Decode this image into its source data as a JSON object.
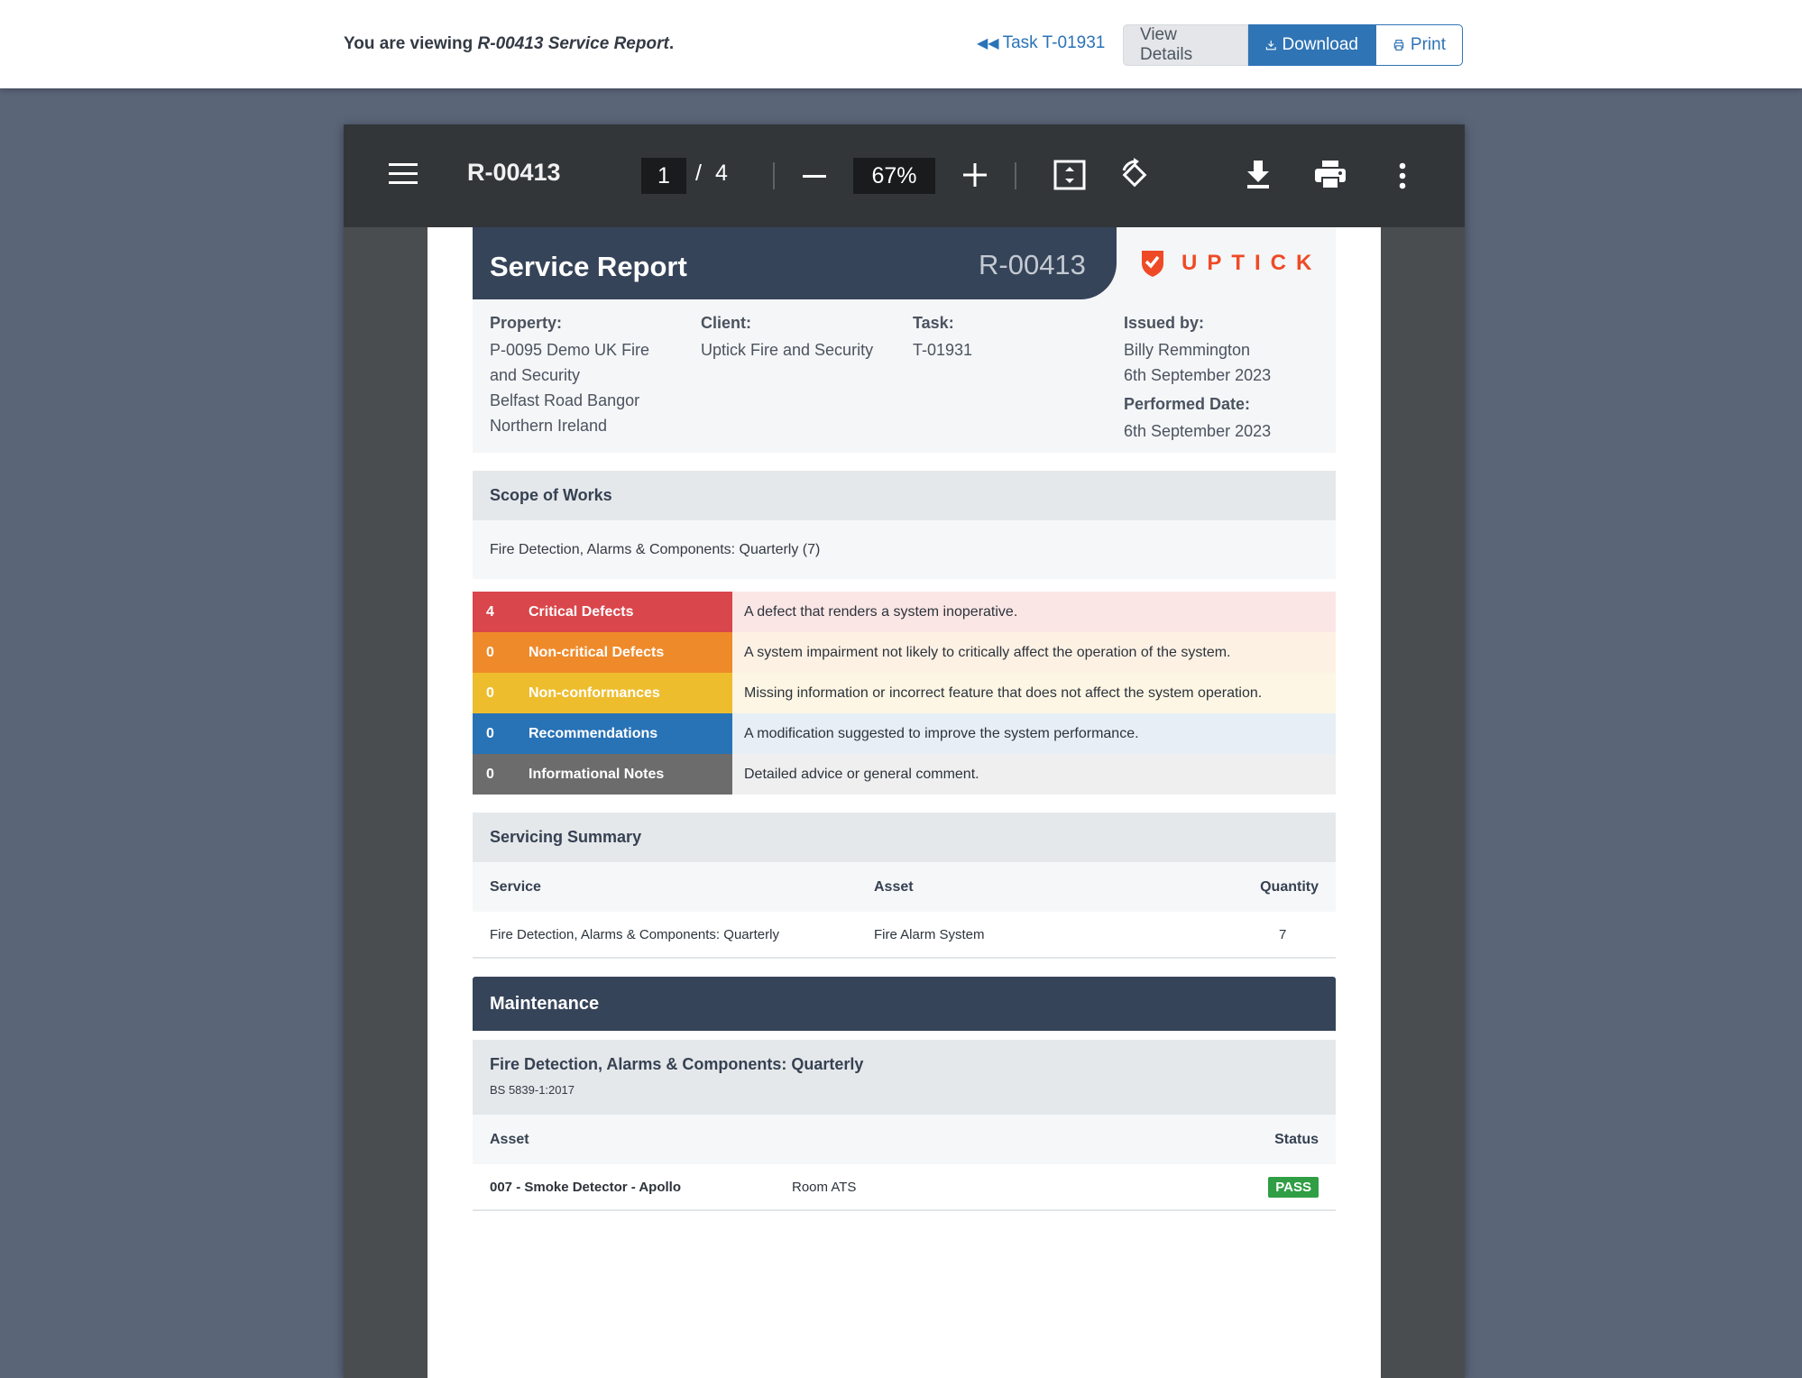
{
  "topbar": {
    "viewing_prefix": "You are viewing ",
    "viewing_doc": "R-00413 Service Report",
    "viewing_suffix": ".",
    "task_link": "Task T-01931",
    "view_details": "View Details",
    "download": "Download",
    "print": "Print"
  },
  "viewer": {
    "title": "R-00413",
    "page_current": "1",
    "page_sep": "/",
    "page_total": "4",
    "zoom": "67%"
  },
  "report": {
    "title": "Service Report",
    "id": "R-00413",
    "logo_text": "UPTICK",
    "property_label": "Property:",
    "property_lines": [
      "P-0095 Demo UK Fire",
      "and Security",
      "Belfast Road Bangor",
      "Northern Ireland"
    ],
    "client_label": "Client:",
    "client_value": "Uptick Fire and Security",
    "task_label": "Task:",
    "task_value": "T-01931",
    "issued_label": "Issued by:",
    "issued_name": "Billy Remmington",
    "issued_date": "6th September 2023",
    "performed_label": "Performed Date:",
    "performed_date": "6th September 2023"
  },
  "scope": {
    "title": "Scope of Works",
    "text": "Fire Detection, Alarms & Components: Quarterly (7)"
  },
  "severities": [
    {
      "count": "4",
      "label": "Critical Defects",
      "desc": "A defect that renders a system inoperative.",
      "color": "#d9464b",
      "bg": "#fbe6e6"
    },
    {
      "count": "0",
      "label": "Non-critical Defects",
      "desc": "A system impairment not likely to critically affect the operation of the system.",
      "color": "#ef8a2a",
      "bg": "#fdf1e4"
    },
    {
      "count": "0",
      "label": "Non-conformances",
      "desc": "Missing information or incorrect feature that does not affect the system operation.",
      "color": "#eebd2e",
      "bg": "#fdf6e4"
    },
    {
      "count": "0",
      "label": "Recommendations",
      "desc": "A modification suggested to improve the system performance.",
      "color": "#2872b6",
      "bg": "#e7eef5"
    },
    {
      "count": "0",
      "label": "Informational Notes",
      "desc": "Detailed advice or general comment.",
      "color": "#6c6c6c",
      "bg": "#efefef"
    }
  ],
  "summary": {
    "title": "Servicing Summary",
    "col_service": "Service",
    "col_asset": "Asset",
    "col_quantity": "Quantity",
    "row": {
      "service": "Fire Detection, Alarms & Components: Quarterly",
      "asset": "Fire Alarm System",
      "quantity": "7"
    }
  },
  "maintenance": {
    "title": "Maintenance",
    "group_title": "Fire Detection, Alarms & Components: Quarterly",
    "group_standard": "BS 5839-1:2017",
    "col_asset": "Asset",
    "col_status": "Status",
    "row": {
      "asset": "007 - Smoke Detector - Apollo",
      "location": "Room ATS",
      "status": "PASS"
    }
  }
}
